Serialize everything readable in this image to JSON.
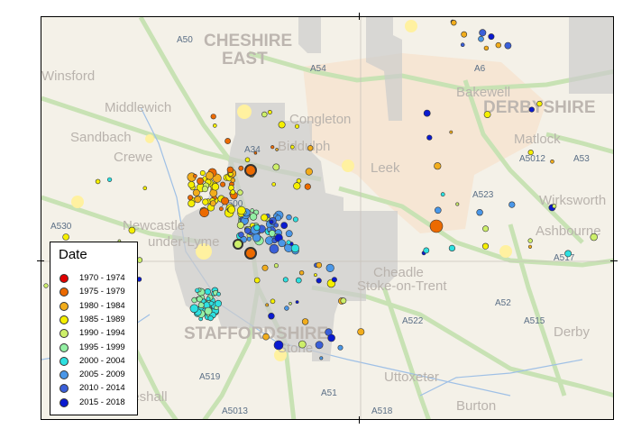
{
  "legend": {
    "title": "Date",
    "items": [
      {
        "label": "1970 - 1974",
        "color": "#e00000"
      },
      {
        "label": "1975 - 1979",
        "color": "#ec6a00"
      },
      {
        "label": "1980 - 1984",
        "color": "#f2ad1c"
      },
      {
        "label": "1985 - 1989",
        "color": "#f5ef00"
      },
      {
        "label": "1990 - 1994",
        "color": "#cdef6a"
      },
      {
        "label": "1995 - 1999",
        "color": "#94f0a4"
      },
      {
        "label": "2000 - 2004",
        "color": "#2de0e0"
      },
      {
        "label": "2005 - 2009",
        "color": "#4a97e8"
      },
      {
        "label": "2010 - 2014",
        "color": "#3a5fd8"
      },
      {
        "label": "2015 - 2018",
        "color": "#0a1ad0"
      }
    ]
  },
  "places": [
    "Sandbach",
    "Middlewich",
    "Crewe",
    "Congleton",
    "Biddulph",
    "Leek",
    "Bakewell",
    "Matlock",
    "Wirksworth",
    "Ashbourne",
    "Newcastle",
    "under-Lyme",
    "Stoke-on-Trent",
    "Cheadle",
    "Uttoxeter",
    "Stone",
    "Eccleshall",
    "Burton",
    "Derby",
    "DERBYSHIRE",
    "STAFFORDSHIRE",
    "CHESHIRE",
    "EAST",
    "Winsford"
  ],
  "roads": [
    "A50",
    "A54",
    "A523",
    "A53",
    "A5012",
    "A517",
    "A52",
    "A515",
    "A522",
    "A51",
    "A518",
    "A519",
    "A5013",
    "A530",
    "A500",
    "A34",
    "A6"
  ],
  "colors": {
    "map_background": "#f4f1e8",
    "peak_district": "#f5e7d6",
    "coverage_area": "#cfcfcf",
    "road": "#c9e3b6",
    "town": "#fff3a8"
  }
}
